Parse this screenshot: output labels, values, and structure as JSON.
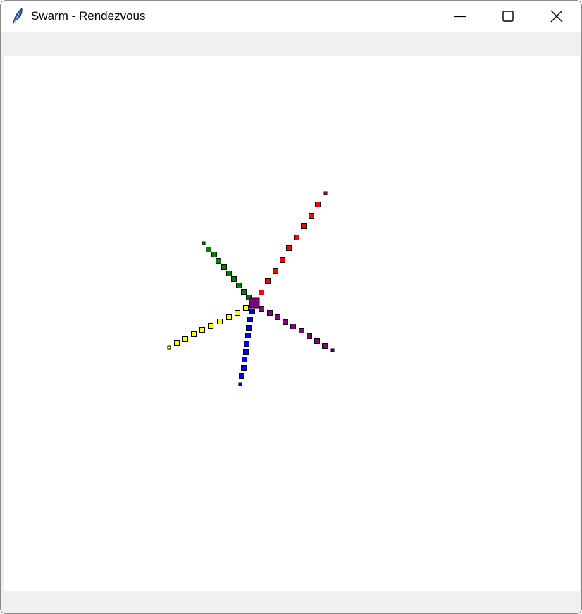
{
  "window": {
    "title": "Swarm - Rendezvous",
    "icon": "feather-icon",
    "controls": {
      "minimize": "minimize-icon",
      "maximize": "maximize-icon",
      "close": "close-icon"
    }
  },
  "swarm": {
    "center_color": "#800080",
    "arms": [
      {
        "name": "red",
        "color": "#ff0000"
      },
      {
        "name": "green",
        "color": "#008000"
      },
      {
        "name": "yellow",
        "color": "#ffff00"
      },
      {
        "name": "blue",
        "color": "#0000ff"
      },
      {
        "name": "purple",
        "color": "#800080"
      }
    ]
  }
}
